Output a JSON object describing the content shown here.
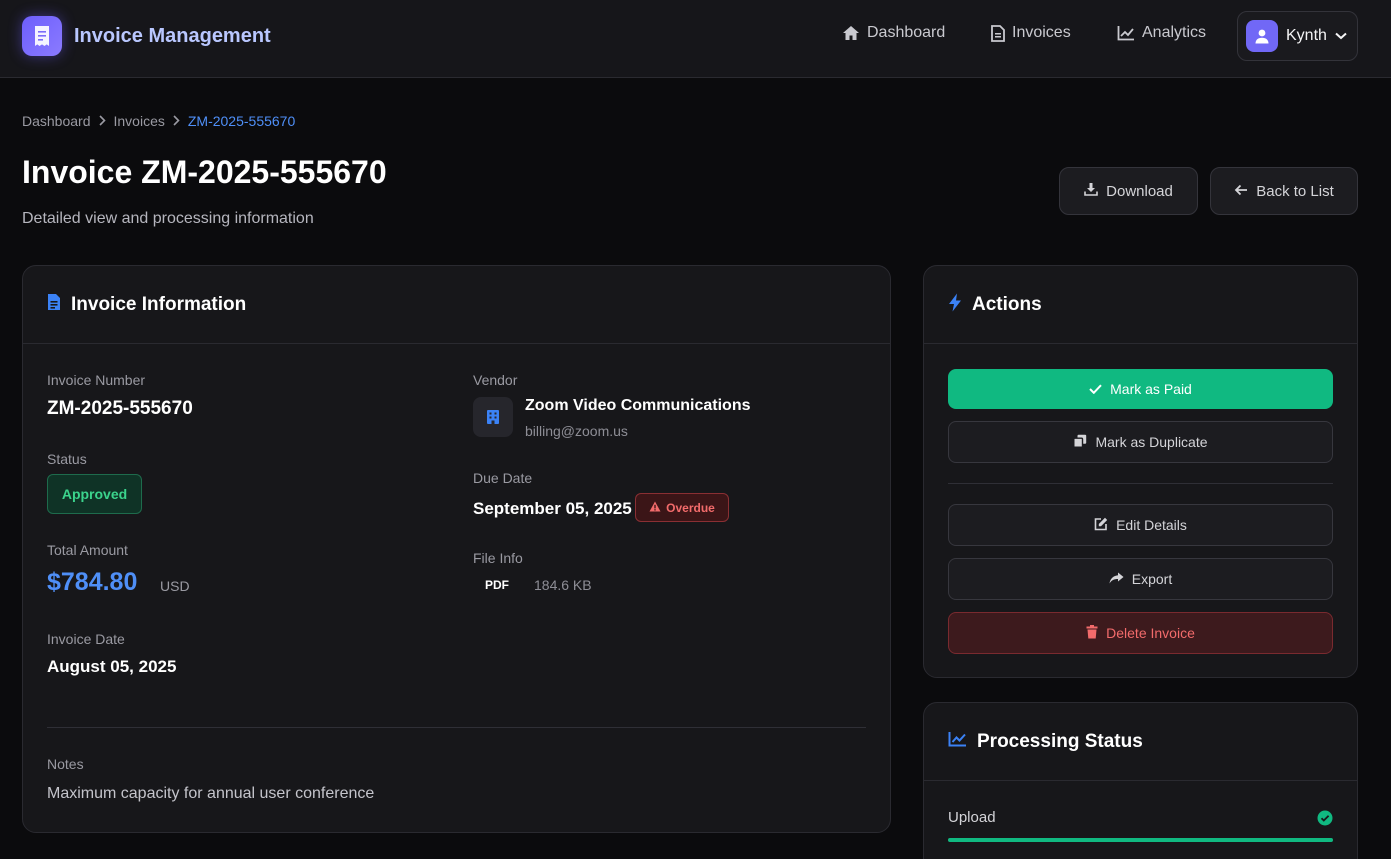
{
  "app": {
    "title": "Invoice Management"
  },
  "nav": [
    {
      "label": "Dashboard",
      "icon": "home-icon"
    },
    {
      "label": "Invoices",
      "icon": "file-icon"
    },
    {
      "label": "Analytics",
      "icon": "chart-line-icon"
    }
  ],
  "user": {
    "name": "Kynth"
  },
  "breadcrumb": [
    "Dashboard",
    "Invoices",
    "ZM-2025-555670"
  ],
  "page": {
    "title": "Invoice ZM-2025-555670",
    "subtitle": "Detailed view and processing information",
    "download_label": "Download",
    "back_label": "Back to List"
  },
  "invoice_info": {
    "title": "Invoice Information",
    "invoice_number_label": "Invoice Number",
    "invoice_number": "ZM-2025-555670",
    "status_label": "Status",
    "status": "Approved",
    "total_label": "Total Amount",
    "total": "$784.80",
    "currency": "USD",
    "invoice_date_label": "Invoice Date",
    "invoice_date": "August 05, 2025",
    "vendor_label": "Vendor",
    "vendor_name": "Zoom Video Communications",
    "vendor_email": "billing@zoom.us",
    "due_date_label": "Due Date",
    "due_date": "September 05, 2025",
    "overdue_label": "Overdue",
    "file_info_label": "File Info",
    "file_type": "PDF",
    "file_size": "184.6 KB",
    "notes_label": "Notes",
    "notes": "Maximum capacity for annual user conference"
  },
  "actions": {
    "title": "Actions",
    "mark_paid": "Mark as Paid",
    "mark_duplicate": "Mark as Duplicate",
    "edit_details": "Edit Details",
    "export": "Export",
    "delete_invoice": "Delete Invoice"
  },
  "processing": {
    "title": "Processing Status",
    "steps": [
      {
        "label": "Upload",
        "status": "complete",
        "progress": 1.0
      }
    ]
  },
  "colors": {
    "accent": "#4f8ff7",
    "success": "#10b981",
    "danger": "#f26b6b",
    "brand": "#6d5efc"
  }
}
